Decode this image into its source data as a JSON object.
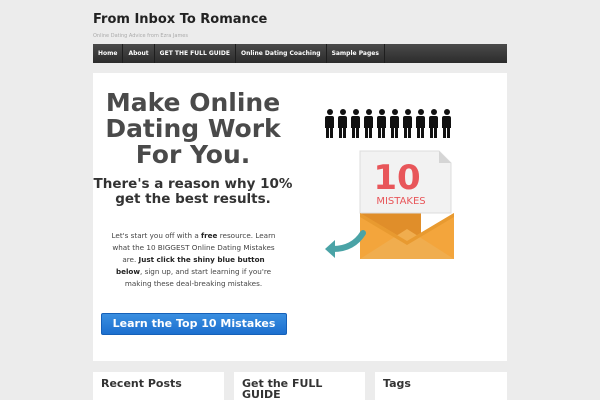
{
  "site": {
    "title": "From Inbox To Romance",
    "tagline": "Online Dating Advice from Ezra James"
  },
  "nav": {
    "items": [
      {
        "label": "Home"
      },
      {
        "label": "About"
      },
      {
        "label": "GET THE FULL GUIDE"
      },
      {
        "label": "Online Dating Coaching"
      },
      {
        "label": "Sample Pages"
      }
    ]
  },
  "hero": {
    "title": "Make Online Dating Work For You.",
    "subtitle": "There's a reason why 10% get the best results.",
    "body": {
      "p1": "Let's start you off with a ",
      "free": "free",
      "p2": " resource. Learn what the 10 BIGGEST Online Dating Mistakes are. ",
      "bold": "Just click the shiny blue button below",
      "p3": ", sign up, and start learning if you're making these deal-breaking mistakes."
    },
    "cta_label": "Learn the Top 10 Mistakes",
    "image": {
      "number": "10",
      "word": "MISTAKES",
      "people_count": 10
    }
  },
  "widgets": [
    {
      "title": "Recent Posts"
    },
    {
      "title": "Get the FULL GUIDE"
    },
    {
      "title": "Tags"
    }
  ],
  "colors": {
    "cta": "#1c6fcf",
    "envelope": "#f3a53c",
    "number": "#e8565a",
    "arrow": "#4aa3a6"
  }
}
